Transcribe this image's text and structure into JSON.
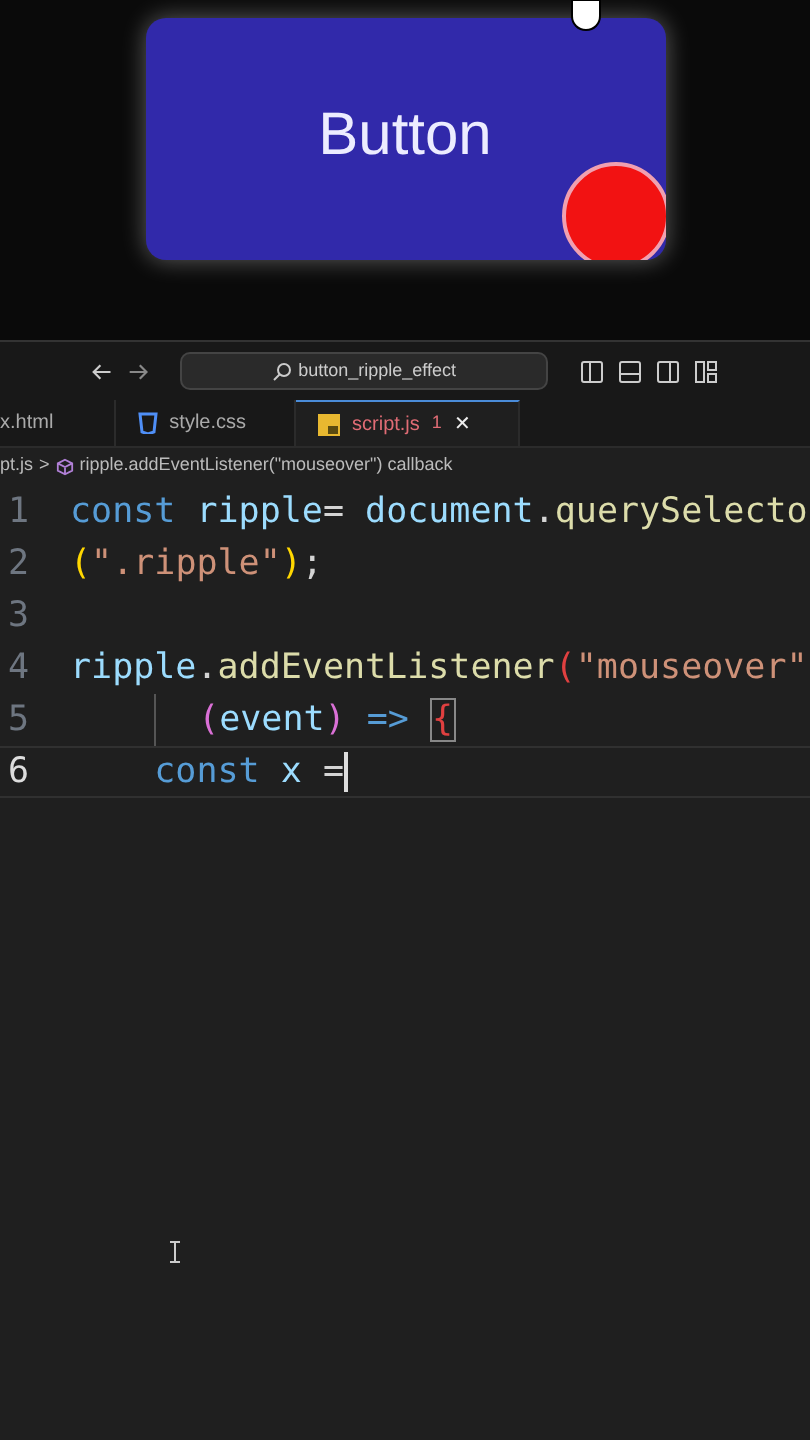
{
  "preview": {
    "button_label": "Button"
  },
  "title_bar": {
    "search": "button_ripple_effect"
  },
  "tabs": [
    {
      "label": "x.html",
      "kind": "html",
      "selected": false
    },
    {
      "label": "style.css",
      "kind": "css",
      "selected": false
    },
    {
      "label": "script.js",
      "kind": "js",
      "selected": true,
      "problems": "1",
      "close": "✕"
    }
  ],
  "breadcrumb": {
    "file": "pt.js",
    "separator": ">",
    "symbol": "ripple.addEventListener(\"mouseover\") callback"
  },
  "code_lines": [
    {
      "number": "1",
      "selected": false,
      "tokens": [
        {
          "text": "const",
          "kind": "keyword"
        },
        {
          "text": " ripple",
          "kind": "variable"
        },
        {
          "text": "= ",
          "kind": "punct"
        },
        {
          "text": "document",
          "kind": "variable"
        },
        {
          "text": ".",
          "kind": "punct"
        },
        {
          "text": "querySelecto",
          "kind": "function"
        }
      ]
    },
    {
      "number": "2",
      "selected": false,
      "tokens": [
        {
          "text": "(",
          "kind": "paren1"
        },
        {
          "text": "\".ripple\"",
          "kind": "string"
        },
        {
          "text": ")",
          "kind": "paren1"
        },
        {
          "text": ";",
          "kind": "punct"
        }
      ]
    },
    {
      "number": "3",
      "selected": false
    },
    {
      "number": "4",
      "selected": false,
      "tokens": [
        {
          "text": "ripple",
          "kind": "variable"
        },
        {
          "text": ".",
          "kind": "punct"
        },
        {
          "text": "addEventListener",
          "kind": "function"
        },
        {
          "text": "(",
          "kind": "error"
        },
        {
          "text": "\"mouseover\"",
          "kind": "string"
        }
      ]
    },
    {
      "number": "5",
      "selected": false,
      "guide": true,
      "tokens": [
        {
          "text": "  (",
          "kind": "paren2"
        },
        {
          "text": "event",
          "kind": "variable"
        },
        {
          "text": ")",
          "kind": "paren2"
        },
        {
          "text": " => ",
          "kind": "keyword"
        },
        {
          "text": "{",
          "kind": "match"
        }
      ]
    },
    {
      "number": "6",
      "selected": true,
      "cursor": true,
      "tokens": [
        {
          "text": "    const",
          "kind": "keyword"
        },
        {
          "text": " x",
          "kind": "variable"
        },
        {
          "text": " =",
          "kind": "punct"
        }
      ]
    }
  ]
}
